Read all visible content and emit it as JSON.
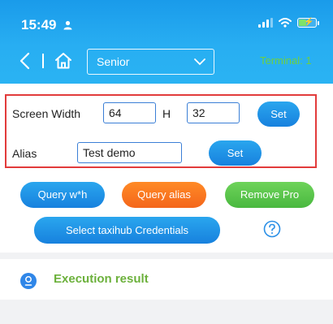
{
  "status_bar": {
    "time": "15:49",
    "person_icon": "person-icon",
    "signal_icon": "signal-icon",
    "wifi_icon": "wifi-icon",
    "battery_icon": "battery-charging-icon"
  },
  "nav": {
    "back_icon": "chevron-left-icon",
    "home_icon": "home-icon",
    "selector_value": "Senior",
    "selector_icon": "chevron-down-icon",
    "terminal_text": "Terminal:  1"
  },
  "settings_panel": {
    "width_label": "Screen Width",
    "width_value": "64",
    "height_label": "H",
    "height_value": "32",
    "size_set_label": "Set",
    "alias_label": "Alias",
    "alias_value": "Test demo",
    "alias_set_label": "Set"
  },
  "actions": {
    "query_wh_label": "Query w*h",
    "query_alias_label": "Query alias",
    "remove_pro_label": "Remove Pro",
    "select_credentials_label": "Select taxihub Credentials",
    "help_icon": "help-circle-icon"
  },
  "result": {
    "icon": "result-icon",
    "title": "Execution result"
  },
  "colors": {
    "header": "#1a9bea",
    "highlight_border": "#e23b3b",
    "orange_button": "#f4661b",
    "green_button": "#49b83f",
    "result_title": "#6cb13c",
    "terminal_text": "#6fcf3f"
  }
}
